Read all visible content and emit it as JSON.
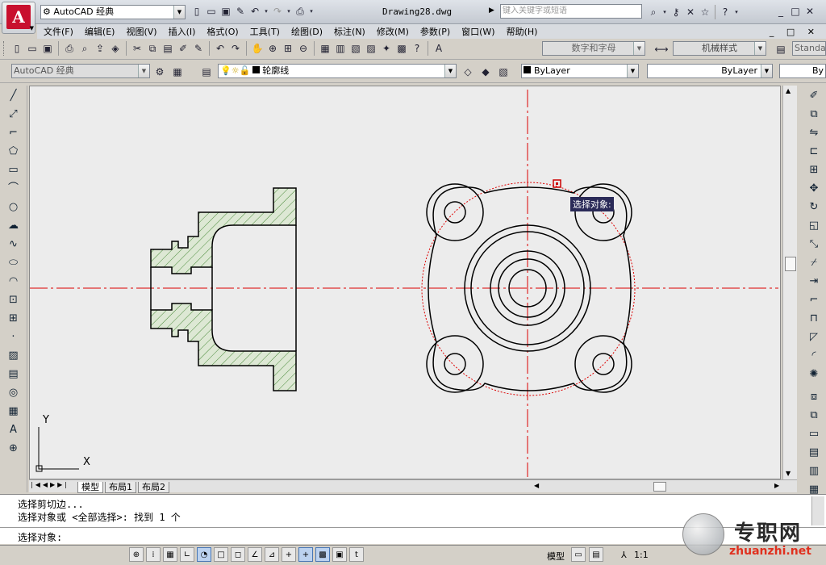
{
  "title_bar": {
    "workspace": "AutoCAD 经典",
    "filename": "Drawing28.dwg",
    "search_placeholder": "键入关键字或短语",
    "app_letter": "A"
  },
  "menu": [
    "文件(F)",
    "编辑(E)",
    "视图(V)",
    "插入(I)",
    "格式(O)",
    "工具(T)",
    "绘图(D)",
    "标注(N)",
    "修改(M)",
    "参数(P)",
    "窗口(W)",
    "帮助(H)"
  ],
  "toolbar2": {
    "text_style": "数字和字母",
    "dim_style": "机械样式",
    "table_style": "Standa"
  },
  "toolbar3": {
    "workspace": "AutoCAD 经典",
    "layer": "轮廓线",
    "color": "ByLayer",
    "linetype": "ByLayer",
    "lineweight": "By"
  },
  "canvas": {
    "tooltip": "选择对象:",
    "ucs_x": "X",
    "ucs_y": "Y"
  },
  "layout_tabs": [
    "模型",
    "布局1",
    "布局2"
  ],
  "command_lines": [
    "选择剪切边...",
    "选择对象或 <全部选择>:  找到 1 个",
    "选择对象:"
  ],
  "status": {
    "model": "模型",
    "scale": "1:1"
  },
  "watermark": {
    "cn": "专职网",
    "url": "zhuanzhi.net"
  }
}
